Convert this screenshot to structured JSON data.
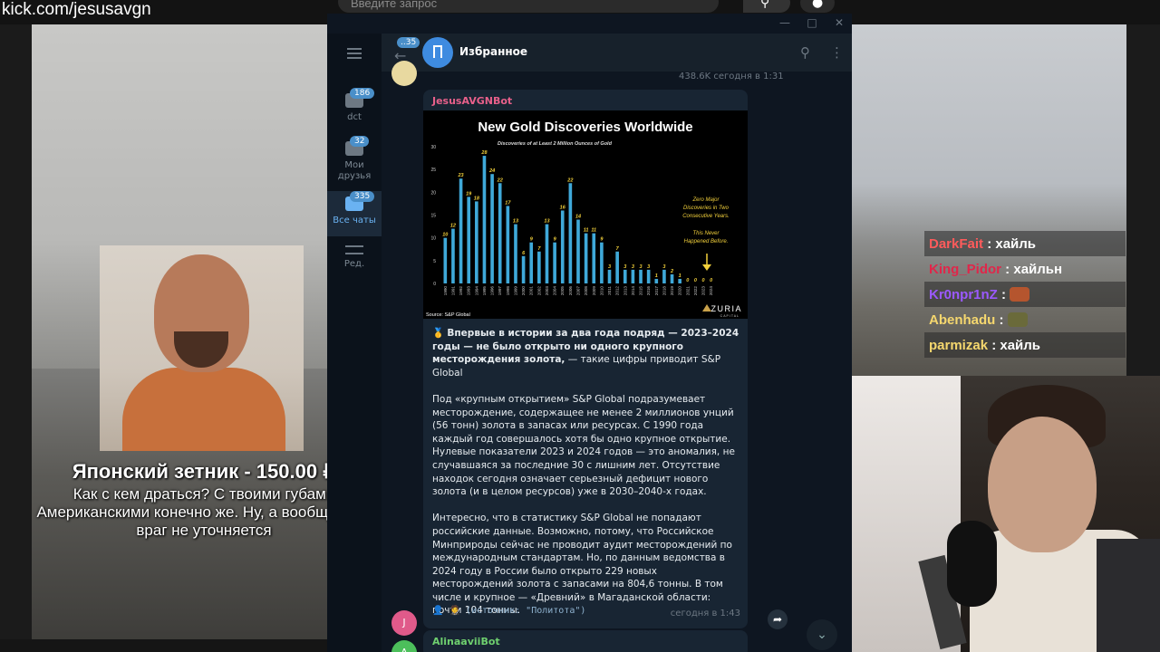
{
  "stream": {
    "url": "kick.com/jesusavgn",
    "search_placeholder": "Введите запрос",
    "donation": {
      "title": "Японский зетник - 150.00 ₽",
      "message": "Как с кем драться? С твоими губами Американскими конечно же. Ну, а вообще, там враг не уточняется"
    },
    "chat": [
      {
        "user": "DarkFait",
        "color": "#ff5b5b",
        "text": ": хайль",
        "emote": false
      },
      {
        "user": "King_Pidor",
        "color": "#e0264a",
        "text": ": хайльн",
        "emote": false
      },
      {
        "user": "Kr0npr1nZ",
        "color": "#9b59ff",
        "text": ":",
        "emote": true
      },
      {
        "user": "Abenhadu",
        "color": "#f5d76e",
        "text": ":",
        "emote": true
      },
      {
        "user": "parmizak",
        "color": "#f5d76e",
        "text": ": хайль",
        "emote": false
      }
    ]
  },
  "telegram": {
    "sidebar": [
      {
        "label": "dct",
        "badge": "186"
      },
      {
        "label": "Мои друзья",
        "badge": "32"
      },
      {
        "label": "Все чаты",
        "badge": "335",
        "active": true
      },
      {
        "label": "Ред.",
        "badge": ""
      }
    ],
    "header": {
      "back_badge": "35",
      "title": "Избранное"
    },
    "prev_meta": "438.6K   сегодня в 1:31",
    "message": {
      "sender": "JesusAVGNBot",
      "bold_text": "Впервые в истории за два года подряд — 2023–2024 годы — не было открыто ни одного крупного месторождения золота,",
      "bold_tail": " — такие цифры приводит S&P Global",
      "para2": "Под «крупным открытием» S&P Global подразумевает месторождение, содержащее не менее 2 миллионов унций (56 тонн) золота в запасах или ресурсах. С 1990 года каждый год совершалось хотя бы одно крупное открытие. Нулевые показатели 2023 и 2024 годов — это аномалия, не случавшаяся за последние 30 с лишним лет. Отсутствие находок сегодня означает серьезный дефицит нового золота (и в целом ресурсов) уже в 2030–2040-х годах.",
      "para3": "Интересно, что в статистику S&P Global не попадают российские данные. Возможно, потому, что Российское Минприроды сейчас не проводит аудит месторождений по международным стандартам. Но, по данным ведомства в 2024 году в России было открыто 229 новых месторождений золота с запасами на 804,6 тонны. В том числе и крупное — «Древний» в Магаданской области: почти 104 тонны.",
      "source": "(источник: \"Политота\")",
      "time": "сегодня в 1:43"
    },
    "avatar_j": "J",
    "avatar_a": "A",
    "next_sender": "AlinaaviiBot"
  },
  "chart_data": {
    "type": "bar",
    "title": "New Gold Discoveries Worldwide",
    "subtitle": "Discoveries of at Least 2 Million Ounces of Gold",
    "categories": [
      "1990",
      "1991",
      "1992",
      "1993",
      "1994",
      "1995",
      "1996",
      "1997",
      "1998",
      "1999",
      "2000",
      "2001",
      "2002",
      "2003",
      "2004",
      "2005",
      "2006",
      "2007",
      "2008",
      "2009",
      "2010",
      "2011",
      "2012",
      "2013",
      "2014",
      "2015",
      "2016",
      "2017",
      "2018",
      "2019",
      "2020",
      "2021",
      "2022",
      "2023",
      "2024"
    ],
    "values": [
      10,
      12,
      23,
      19,
      18,
      28,
      24,
      22,
      17,
      13,
      6,
      9,
      7,
      13,
      9,
      16,
      22,
      14,
      11,
      11,
      9,
      3,
      7,
      3,
      3,
      3,
      3,
      1,
      3,
      2,
      1,
      0,
      0,
      0,
      0
    ],
    "data_labels": [
      "10",
      "12",
      "23",
      "19",
      "18",
      "28",
      "24",
      "22",
      "17",
      "13",
      "6",
      "9",
      "7",
      "13",
      "9",
      "16",
      "22",
      "14",
      "11",
      "11",
      "9",
      "3",
      "7",
      "3",
      "3",
      "3",
      "3",
      "1",
      "3",
      "2",
      "1",
      "0",
      "0",
      "0",
      "0"
    ],
    "ylim": [
      0,
      30
    ],
    "yticks": [
      "0",
      "5",
      "10",
      "15",
      "20",
      "25",
      "30"
    ],
    "annotation1": [
      "Zero Major",
      "Discoveries in Two",
      "Consecutive Years."
    ],
    "annotation2": [
      "This Never",
      "Happened Before."
    ],
    "source": "Source: S&P Global",
    "brand": "AZURIA",
    "brand_sub": "CAPITAL",
    "bar_color": "#3fa9d9",
    "label_color": "#f2d03b"
  }
}
